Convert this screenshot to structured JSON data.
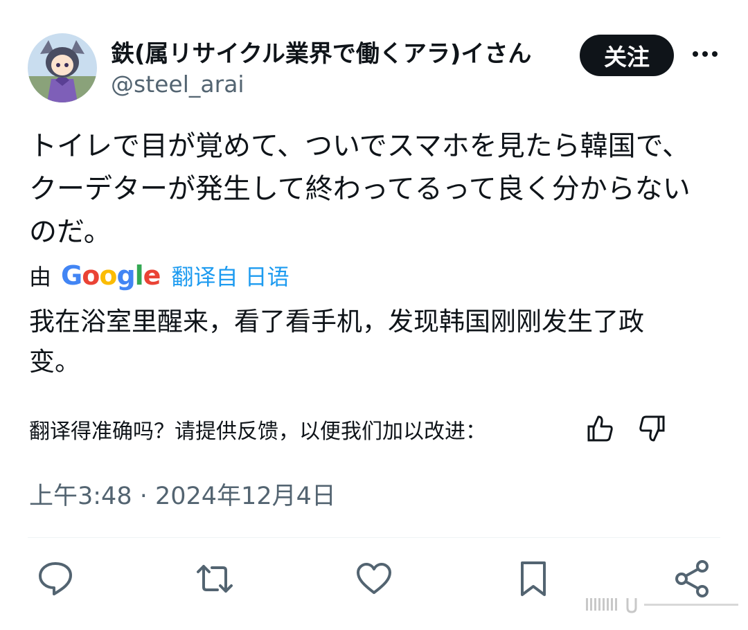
{
  "author": {
    "display_name": "鉄(属リサイクル業界で働くアラ)イさん",
    "handle": "@steel_arai",
    "avatar_icon": "anime-avatar"
  },
  "follow_button": {
    "label": "关注"
  },
  "more_icon": "more-icon",
  "tweet": {
    "lines": [
      "トイレで目が覚めて、ついでスマホを見たら韓国で、",
      "クーデターが発生して終わってるって良く分からない",
      "のだ。"
    ]
  },
  "translation": {
    "by": "由",
    "engine": "Google",
    "label": "翻译自 日语",
    "lines": [
      "我在浴室里醒来，看了看手机，发现韩国刚刚发生了政",
      "变。"
    ],
    "feedback_prompt": "翻译得准确吗？请提供反馈，以便我们加以改进：",
    "thumbs_up_icon": "thumbs-up-icon",
    "thumbs_down_icon": "thumbs-down-icon"
  },
  "timestamp": "上午3:48 · 2024年12月4日",
  "actions": [
    "reply-icon",
    "retweet-icon",
    "like-icon",
    "bookmark-icon",
    "share-icon"
  ],
  "colors": {
    "text": "#0f1419",
    "secondary": "#536471",
    "accent": "#1d9bf0",
    "google_blue": "#4285f4",
    "google_red": "#ea4335",
    "google_yellow": "#fbbc05",
    "google_green": "#34a853"
  }
}
